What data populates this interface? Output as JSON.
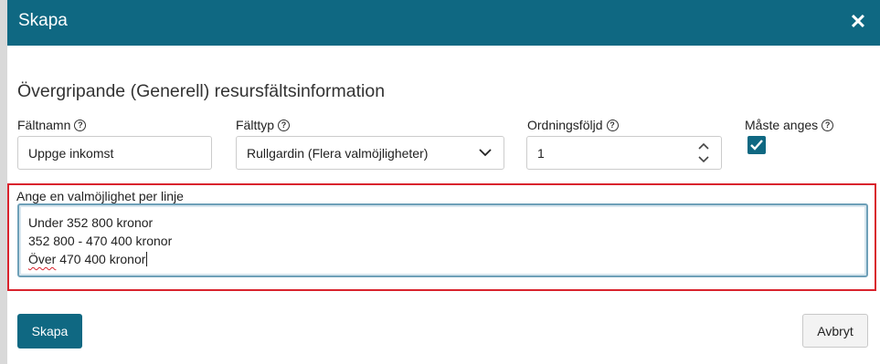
{
  "dialog": {
    "title": "Skapa",
    "close_symbol": "✕"
  },
  "form": {
    "section_title": "Övergripande (Generell) resursfältsinformation",
    "field_name": {
      "label": "Fältnamn",
      "value": "Uppge inkomst"
    },
    "field_type": {
      "label": "Fälttyp",
      "value": "Rullgardin (Flera valmöjligheter)"
    },
    "order": {
      "label": "Ordningsföljd",
      "value": "1"
    },
    "required": {
      "label": "Måste anges",
      "checked": true
    },
    "options": {
      "label": "Ange en valmöjlighet per linje",
      "lines": [
        "Under 352 800 kronor",
        "352 800 - 470 400 kronor"
      ],
      "line3_word": "Över",
      "line3_rest": " 470 400 kronor"
    }
  },
  "buttons": {
    "create": "Skapa",
    "cancel": "Avbryt"
  },
  "colors": {
    "header": "#0f6882",
    "accent": "#0f6882",
    "highlight_border": "#d9232d"
  },
  "icons": {
    "close": "close-icon",
    "help": "help-circle-icon",
    "dropdown": "chevron-down-icon",
    "spinner": "spinner-arrows-icon",
    "checkmark": "checkmark-icon"
  }
}
